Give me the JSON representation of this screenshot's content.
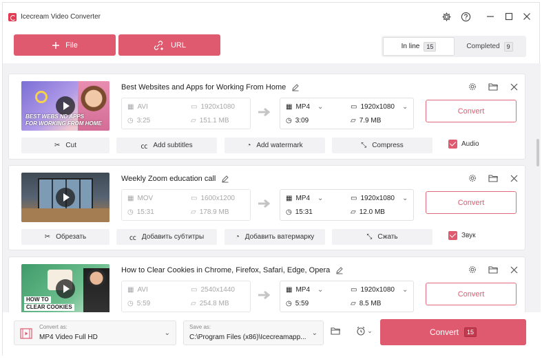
{
  "app": {
    "title": "Icecream Video Converter"
  },
  "toolbar": {
    "file_label": "File",
    "url_label": "URL"
  },
  "tabs": [
    {
      "label": "In line",
      "count": "15"
    },
    {
      "label": "Completed",
      "count": "9"
    }
  ],
  "items": [
    {
      "title": "Best Websites and Apps for Working From Home",
      "thumb_caption_1": "BEST WEBS  ND APPS",
      "thumb_caption_2": "FOR WORKING FROM HOME",
      "src_format": "AVI",
      "src_resolution": "1920x1080",
      "src_duration": "3:25",
      "src_size": "151.1 MB",
      "dst_format": "MP4",
      "dst_resolution": "1920x1080",
      "dst_duration": "3:09",
      "dst_size": "7.9 MB",
      "convert_label": "Convert",
      "tools": {
        "cut": "Cut",
        "subtitles": "Add subtitles",
        "watermark": "Add watermark",
        "compress": "Compress",
        "audio": "Audio"
      }
    },
    {
      "title": "Weekly Zoom education call",
      "src_format": "MOV",
      "src_resolution": "1600x1200",
      "src_duration": "15:31",
      "src_size": "178.9 MB",
      "dst_format": "MP4",
      "dst_resolution": "1920x1080",
      "dst_duration": "15:31",
      "dst_size": "12.0 MB",
      "convert_label": "Convert",
      "tools": {
        "cut": "Обрезать",
        "subtitles": "Добавить субтитры",
        "watermark": "Добавить ватермарку",
        "compress": "Сжать",
        "audio": "Звук"
      }
    },
    {
      "title": "How to Clear Cookies in Chrome, Firefox, Safari, Edge, Opera",
      "thumb_caption_1": "HOW TO",
      "thumb_caption_2": "CLEAR COOKIES",
      "src_format": "AVI",
      "src_resolution": "2540x1440",
      "src_duration": "5:59",
      "src_size": "254.8 MB",
      "dst_format": "MP4",
      "dst_resolution": "1920x1080",
      "dst_duration": "5:59",
      "dst_size": "8.5 MB",
      "convert_label": "Convert"
    }
  ],
  "bottom": {
    "convert_as_label": "Convert as:",
    "convert_as_value": "MP4 Video Full HD",
    "save_as_label": "Save as:",
    "save_as_value": "C:\\Program Files (x86)\\Icecreamapp...",
    "convert_all_label": "Convert",
    "convert_all_count": "15"
  },
  "colors": {
    "accent": "#e05a6f",
    "panel": "#f2f2f4"
  }
}
